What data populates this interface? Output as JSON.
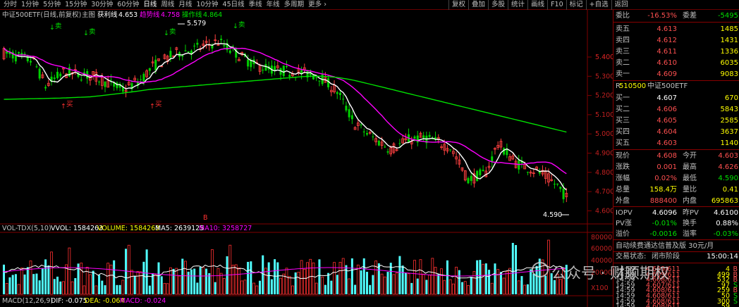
{
  "tabs": {
    "periods": [
      "分时",
      "1分钟",
      "5分钟",
      "15分钟",
      "30分钟",
      "60分钟",
      "日线",
      "周线",
      "月线",
      "10分钟",
      "45日线",
      "季线",
      "年线",
      "多周期",
      "更多 ›"
    ],
    "active": "日线",
    "tools": [
      "复权",
      "叠加",
      "多股",
      "统计",
      "画线",
      "F10",
      "标记",
      "+自选",
      "返回"
    ]
  },
  "chart": {
    "info": {
      "name": "中证500ETF(日线,前复权)",
      "main": "主图",
      "main_name": "获利线",
      "main_val": "4.653",
      "sub1_name": "趋势线",
      "sub1_val": "4.758",
      "sub2_name": "操作线",
      "sub2_val": "4.864"
    },
    "price_axis": [
      "5.400",
      "5.300",
      "5.200",
      "5.100",
      "5.000",
      "4.900",
      "4.800",
      "4.700",
      "4.600"
    ],
    "high_label": "5.579",
    "low_label": "4.590",
    "signals": {
      "sell": "卖",
      "buy": "买",
      "b": "B"
    },
    "vol_info": {
      "name": "VOL-TDX(5,10)",
      "vvol": "VVOL: 1584263",
      "volume": "VOLUME: 1584263",
      "ma5": "MA5: 2639125",
      "ma10": "MA10: 3258727"
    },
    "vol_axis": [
      "80000",
      "60000",
      "40000",
      "20000",
      "X100"
    ],
    "macd_info": {
      "name": "MACD(12,26,9)",
      "dif": "DIF: -0.075",
      "dea": "DEA: -0.064",
      "macd": "MACD: -0.024"
    }
  },
  "panel": {
    "webi": {
      "label": "委比",
      "val": "-16.53%",
      "label2": "委差",
      "val2": "-5495"
    },
    "asks": [
      {
        "label": "卖五",
        "price": "4.613",
        "vol": "1485"
      },
      {
        "label": "卖四",
        "price": "4.612",
        "vol": "1431"
      },
      {
        "label": "卖三",
        "price": "4.611",
        "vol": "1336"
      },
      {
        "label": "卖二",
        "price": "4.610",
        "vol": "6035"
      },
      {
        "label": "卖一",
        "price": "4.609",
        "vol": "9083"
      }
    ],
    "code": "510500",
    "name": "中证500ETF",
    "r": "R",
    "bids": [
      {
        "label": "买一",
        "price": "4.607",
        "vol": "670"
      },
      {
        "label": "买二",
        "price": "4.606",
        "vol": "5843"
      },
      {
        "label": "买三",
        "price": "4.605",
        "vol": "2585"
      },
      {
        "label": "买四",
        "price": "4.604",
        "vol": "3637"
      },
      {
        "label": "买五",
        "price": "4.603",
        "vol": "1140"
      }
    ],
    "quote": [
      {
        "a": "现价",
        "av": "4.608",
        "b": "今开",
        "bv": "4.603"
      },
      {
        "a": "涨跌",
        "av": "0.001",
        "b": "最高",
        "bv": "4.626"
      },
      {
        "a": "涨幅",
        "av": "0.02%",
        "b": "最低",
        "bv": "4.590"
      },
      {
        "a": "总量",
        "av": "158.4万",
        "b": "量比",
        "bv": "0.41"
      },
      {
        "a": "外盘",
        "av": "888400",
        "b": "内盘",
        "bv": "695863"
      }
    ],
    "iopv": [
      {
        "a": "IOPV",
        "av": "4.6096",
        "b": "昨PV",
        "bv": "4.6100"
      },
      {
        "a": "PV涨",
        "av": "-0.01%",
        "b": "换手",
        "bv": "0.88%"
      },
      {
        "a": "溢价",
        "av": "-0.0016",
        "b": "溢率",
        "bv": "-0.03%"
      }
    ],
    "ad": "自动续费通达信普及版  30元/月",
    "status": {
      "label": "交易状态:",
      "val": "闭市阶段",
      "time": "15:00:14"
    },
    "ticks": [
      {
        "t": "14:59",
        "p": "4.609/611",
        "v": "4",
        "s": "B"
      },
      {
        "t": "14:59",
        "p": "4.609/611",
        "v": "499",
        "s": "B"
      },
      {
        "t": "14:59",
        "p": "4.608/611",
        "v": "532",
        "s": "B"
      },
      {
        "t": "14:59",
        "p": "4.607/611",
        "v": "97",
        "s": "S"
      },
      {
        "t": "14:59",
        "p": "4.608/611",
        "v": "259",
        "s": "B"
      },
      {
        "t": "14:59",
        "p": "4.608/611",
        "v": "50",
        "s": "S"
      },
      {
        "t": "14:59",
        "p": "4.608/611",
        "v": "300",
        "s": "S"
      },
      {
        "t": "14:59",
        "p": "4.608/611",
        "v": "59",
        "s": ""
      }
    ]
  },
  "watermark": "公众号 · 财顺期权",
  "colors": {
    "up": "#ff4040",
    "down": "#00e0e0",
    "ma_white": "#ffffff",
    "ma_magenta": "#ff00ff",
    "ma_green": "#00e000",
    "vol_up": "#ff3030",
    "vol_down": "#50ffff",
    "axis": "#800000"
  }
}
